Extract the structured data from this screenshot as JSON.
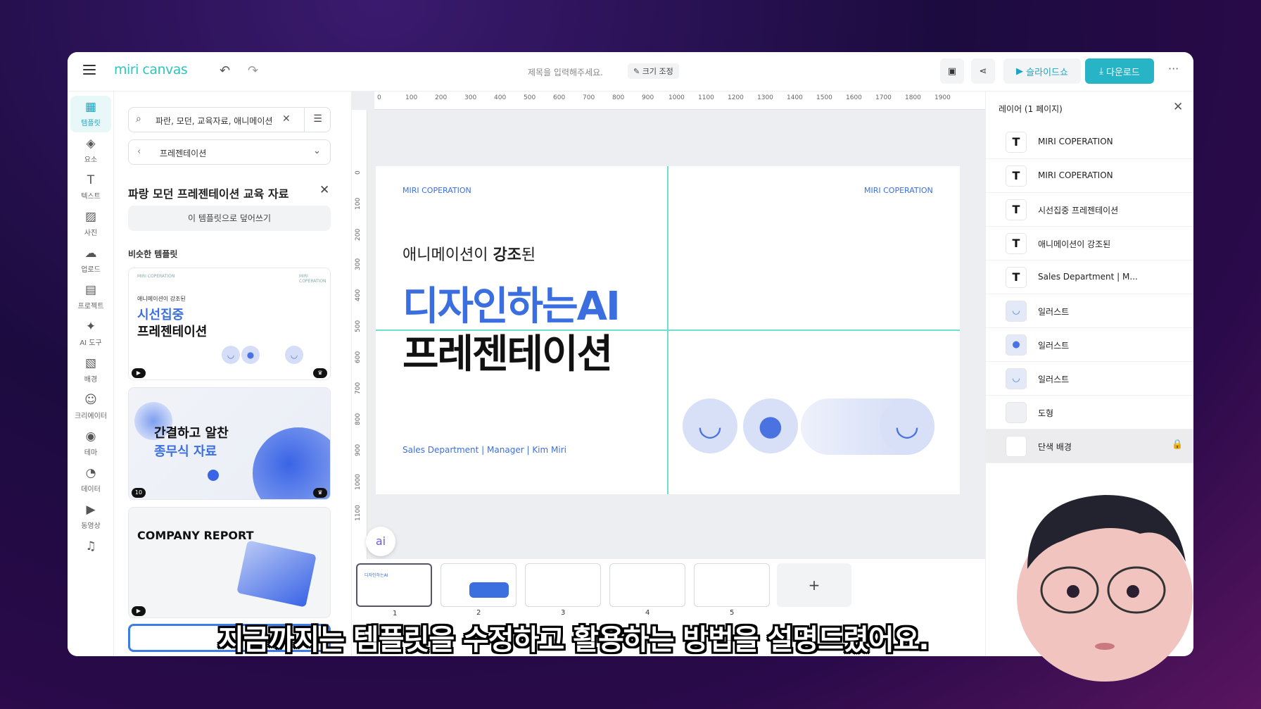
{
  "app": {
    "logo": "miri canvas",
    "doc_title_placeholder": "제목을 입력해주세요.",
    "resize_label": "크기 조정"
  },
  "toolbar": {
    "slideshow_label": "슬라이드쇼",
    "download_label": "다운로드",
    "accent": "#26b4c6"
  },
  "rail": {
    "items": [
      {
        "label": "템플릿",
        "icon": "template-icon"
      },
      {
        "label": "요소",
        "icon": "elements-icon"
      },
      {
        "label": "텍스트",
        "icon": "text-icon"
      },
      {
        "label": "사진",
        "icon": "photo-icon"
      },
      {
        "label": "업로드",
        "icon": "upload-icon"
      },
      {
        "label": "프로젝트",
        "icon": "project-icon"
      },
      {
        "label": "AI 도구",
        "icon": "ai-tools-icon"
      },
      {
        "label": "배경",
        "icon": "background-icon"
      },
      {
        "label": "크리에이터",
        "icon": "creator-icon"
      },
      {
        "label": "테마",
        "icon": "theme-icon"
      },
      {
        "label": "데이터",
        "icon": "data-icon"
      },
      {
        "label": "동영상",
        "icon": "video-icon"
      }
    ]
  },
  "panel": {
    "search_value": "파란, 모던, 교육자료, 애니메이션",
    "category": "프레젠테이션",
    "title": "파랑 모던 프레젠테이션 교육 자료",
    "overwrite_label": "이 템플릿으로 덮어쓰기",
    "similar_label": "비슷한 템플릿",
    "cards": [
      {
        "line1": "애니메이션이 강조된",
        "line2": "시선집중",
        "line3": "프레젠테이션"
      },
      {
        "line1": "간결하고 알찬",
        "line2": "종무식 자료",
        "badge": "10"
      },
      {
        "line1": "COMPANY REPORT"
      }
    ]
  },
  "ruler": {
    "h": [
      "0",
      "100",
      "200",
      "300",
      "400",
      "500",
      "600",
      "700",
      "800",
      "900",
      "1000",
      "1100",
      "1200",
      "1300",
      "1400",
      "1500",
      "1600",
      "1700",
      "1800",
      "1900"
    ],
    "v": [
      "0",
      "100",
      "200",
      "300",
      "400",
      "500",
      "600",
      "700",
      "800",
      "900",
      "1000",
      "1100"
    ]
  },
  "slide": {
    "brand_left": "MIRI COPERATION",
    "brand_right": "MIRI COPERATION",
    "sub_prefix": "애니메이션이 ",
    "sub_bold": "강조",
    "sub_suffix": "된",
    "headline1": "디자인하는AI",
    "headline2": "프레젠테이션",
    "footer": "Sales Department | Manager | Kim Miri"
  },
  "thumbnails": [
    "1",
    "2",
    "3",
    "4",
    "5"
  ],
  "layers": {
    "title": "레이어 (1 페이지)",
    "items": [
      {
        "name": "MIRI COPERATION",
        "type": "text"
      },
      {
        "name": "MIRI COPERATION",
        "type": "text"
      },
      {
        "name": "시선집중 프레젠테이션",
        "type": "text"
      },
      {
        "name": "애니메이션이 강조된",
        "type": "text"
      },
      {
        "name": "Sales Department | M...",
        "type": "text"
      },
      {
        "name": "일러스트",
        "type": "illustration"
      },
      {
        "name": "일러스트",
        "type": "illustration"
      },
      {
        "name": "일러스트",
        "type": "illustration"
      },
      {
        "name": "도형",
        "type": "shape"
      },
      {
        "name": "단색 배경",
        "type": "background"
      }
    ]
  },
  "caption": "지금까지는 템플릿을 수정하고 활용하는 방법을 설명드렸어요."
}
